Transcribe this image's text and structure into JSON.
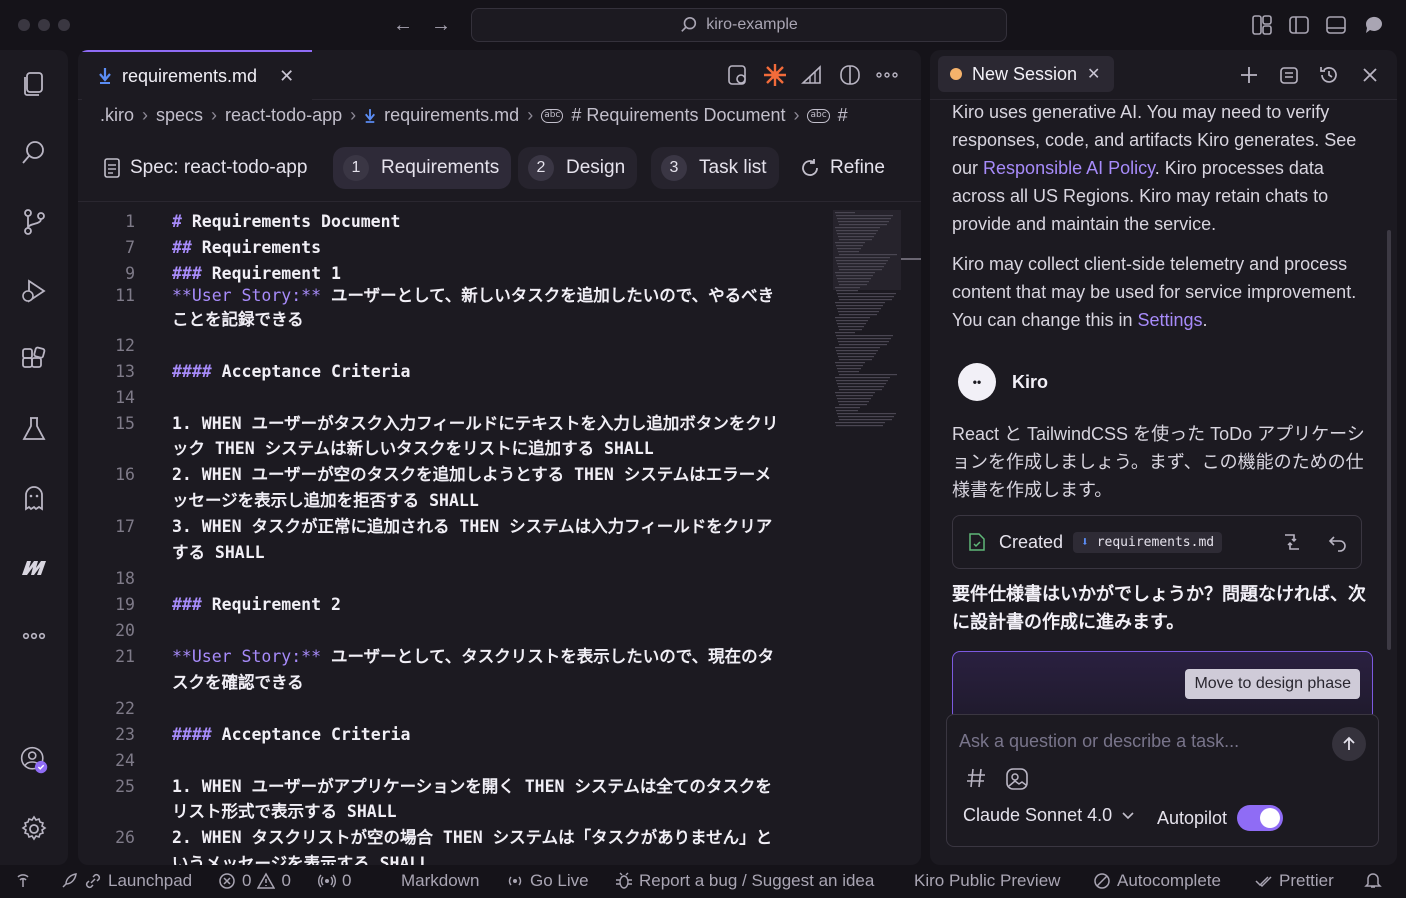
{
  "window": {
    "search_text": "kiro-example"
  },
  "editor": {
    "tab_label": "requirements.md",
    "breadcrumb": [
      ".kiro",
      "specs",
      "react-todo-app",
      "requirements.md",
      "# Requirements Document",
      "#"
    ],
    "spec_label": "Spec: react-todo-app",
    "phases": [
      {
        "num": "1",
        "label": "Requirements"
      },
      {
        "num": "2",
        "label": "Design"
      },
      {
        "num": "3",
        "label": "Task list"
      }
    ],
    "refine_label": "Refine",
    "lines": [
      {
        "n": "1",
        "text": "# Requirements Document"
      },
      {
        "n": "7",
        "text": "## Requirements"
      },
      {
        "n": "9",
        "text": "### Requirement 1"
      },
      {
        "n": "11",
        "text": "**User Story:** ユーザーとして、新しいタスクを追加したいので、やるべき"
      },
      {
        "n": "",
        "text": "ことを記録できる"
      },
      {
        "n": "12",
        "text": ""
      },
      {
        "n": "13",
        "text": "#### Acceptance Criteria"
      },
      {
        "n": "14",
        "text": ""
      },
      {
        "n": "15",
        "text": "1. WHEN ユーザーがタスク入力フィールドにテキストを入力し追加ボタンをクリ"
      },
      {
        "n": "",
        "text": "ック THEN システムは新しいタスクをリストに追加する SHALL"
      },
      {
        "n": "16",
        "text": "2. WHEN ユーザーが空のタスクを追加しようとする THEN システムはエラーメ"
      },
      {
        "n": "",
        "text": "ッセージを表示し追加を拒否する SHALL"
      },
      {
        "n": "17",
        "text": "3. WHEN タスクが正常に追加される THEN システムは入力フィールドをクリア"
      },
      {
        "n": "",
        "text": "する SHALL"
      },
      {
        "n": "18",
        "text": ""
      },
      {
        "n": "19",
        "text": "### Requirement 2"
      },
      {
        "n": "20",
        "text": ""
      },
      {
        "n": "21",
        "text": "**User Story:** ユーザーとして、タスクリストを表示したいので、現在のタ"
      },
      {
        "n": "",
        "text": "スクを確認できる"
      },
      {
        "n": "22",
        "text": ""
      },
      {
        "n": "23",
        "text": "#### Acceptance Criteria"
      },
      {
        "n": "24",
        "text": ""
      },
      {
        "n": "25",
        "text": "1. WHEN ユーザーがアプリケーションを開く THEN システムは全てのタスクを"
      },
      {
        "n": "",
        "text": "リスト形式で表示する SHALL"
      },
      {
        "n": "26",
        "text": "2. WHEN タスクリストが空の場合 THEN システムは「タスクがありません」と"
      },
      {
        "n": "",
        "text": "いうメッセージを表示する SHALL"
      }
    ]
  },
  "chat": {
    "session_tab": "New Session",
    "disclaimer_1_pre": "Kiro uses generative AI. You may need to verify responses, code, and artifacts Kiro generates. See our ",
    "disclaimer_1_link": "Responsible AI Policy",
    "disclaimer_1_post": ". Kiro processes data across all US Regions. Kiro may retain chats to provide and maintain the service.",
    "disclaimer_2_pre": "Kiro may collect client-side telemetry and process content that may be used for service improvement. You can change this in ",
    "disclaimer_2_link": "Settings",
    "disclaimer_2_post": ".",
    "agent_name": "Kiro",
    "agent_message": "React と TailwindCSS を使った ToDo アプリケーションを作成しましょう。まず、この機能のための仕様書を作成します。",
    "created_label": "Created",
    "created_file": "requirements.md",
    "question": "要件仕様書はいかがでしょうか？問題なければ、次に設計書の作成に進みます。",
    "move_button": "Move to design phase",
    "input_placeholder": "Ask a question or describe a task...",
    "model": "Claude Sonnet 4.0",
    "autopilot_label": "Autopilot",
    "autopilot_on": true
  },
  "statusbar": {
    "launchpad": "Launchpad",
    "errors": "0",
    "warnings": "0",
    "ports": "0",
    "language": "Markdown",
    "go_live": "Go Live",
    "report": "Report a bug / Suggest an idea",
    "preview": "Kiro Public Preview",
    "autocomplete": "Autocomplete",
    "prettier": "Prettier"
  },
  "colors": {
    "accent": "#8f6cf5",
    "link": "#a78bfa",
    "background": "#151319",
    "panel": "#1c1a21"
  }
}
